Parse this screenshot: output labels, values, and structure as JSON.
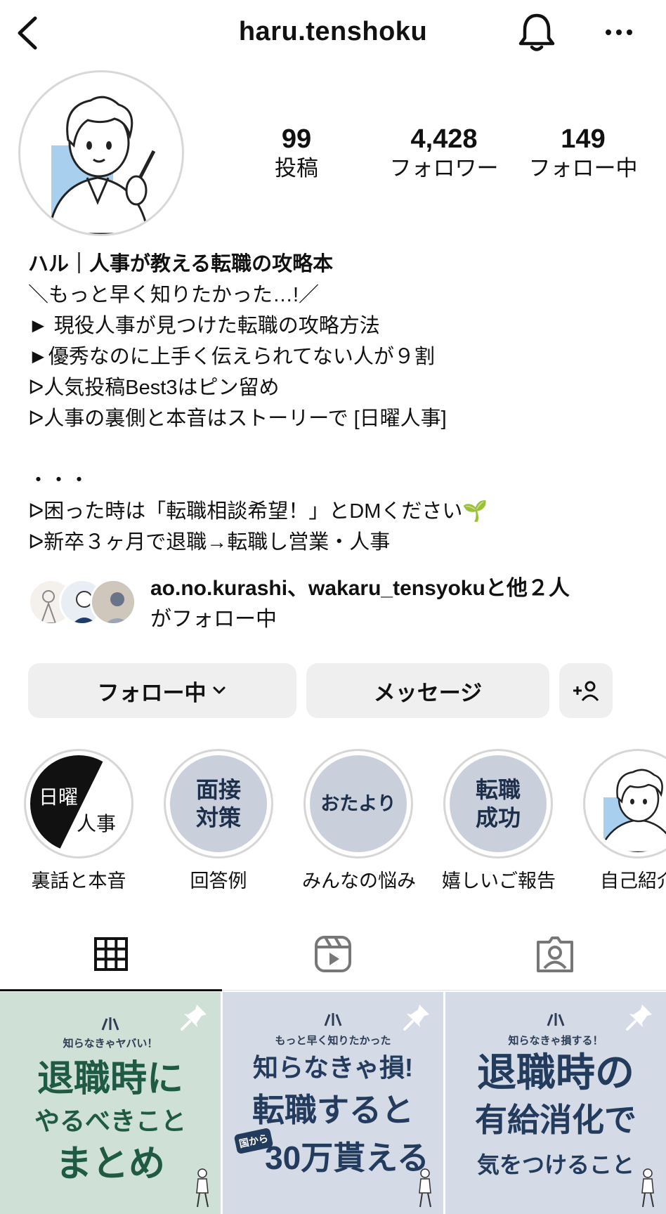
{
  "header": {
    "username": "haru.tenshoku",
    "back_icon": "chevron-left-icon",
    "bell_icon": "bell-icon",
    "more_icon": "more-horizontal-icon"
  },
  "stats": [
    {
      "value": "99",
      "label": "投稿"
    },
    {
      "value": "4,428",
      "label": "フォロワー"
    },
    {
      "value": "149",
      "label": "フォロー中"
    }
  ],
  "bio": {
    "name": "ハル｜人事が教える転職の攻略本",
    "lines": [
      "＼もっと早く知りたかった…!／",
      "► 現役人事が見つけた転職の攻略方法",
      "►優秀なのに上手く伝えられてない人が９割",
      "ᐅ人気投稿Best3はピン留め",
      "ᐅ人事の裏側と本音はストーリーで [日曜人事]",
      "",
      "・・・",
      "ᐅ困った時は「転職相談希望！」とDMください🌱",
      "ᐅ新卒３ヶ月で退職→転職し営業・人事"
    ]
  },
  "followed_by": {
    "names": "ao.no.kurashi、wakaru_tensyoku",
    "suffix": "と他２人",
    "line2": "がフォロー中"
  },
  "actions": {
    "following_label": "フォロー中",
    "message_label": "メッセージ",
    "add_user_icon": "add-user-icon"
  },
  "highlights": [
    {
      "label": "裏話と本音",
      "cover": [
        "日曜",
        "人事"
      ]
    },
    {
      "label": "回答例",
      "cover": [
        "面接",
        "対策"
      ]
    },
    {
      "label": "みんなの悩み",
      "cover": [
        "おたより"
      ]
    },
    {
      "label": "嬉しいご報告",
      "cover": [
        "転職",
        "成功"
      ]
    },
    {
      "label": "自己紹介",
      "cover": []
    }
  ],
  "tabs": [
    {
      "icon": "grid-icon",
      "active": true
    },
    {
      "icon": "reels-icon",
      "active": false
    },
    {
      "icon": "tagged-icon",
      "active": false
    }
  ],
  "posts": [
    {
      "small": "知らなきゃヤバい！",
      "big": [
        "退職時に",
        "やるべきこと",
        "まとめ"
      ],
      "bg": "#cfe0d6",
      "fg": "#1f5a45"
    },
    {
      "small": "もっと早く知りたかった",
      "big": [
        "知らなきゃ損!",
        "転職すると",
        "30万貰える"
      ],
      "tag": "国から",
      "bg": "#d4dae6",
      "fg": "#233b5c"
    },
    {
      "small": "知らなきゃ損する！",
      "big": [
        "退職時の",
        "有給消化で",
        "気をつけること"
      ],
      "bg": "#d4dae6",
      "fg": "#233b5c"
    }
  ],
  "colors": {
    "button_bg": "#efefef",
    "highlight_bg": "#c9d0dc",
    "avatar_blue": "#a9cfee"
  }
}
